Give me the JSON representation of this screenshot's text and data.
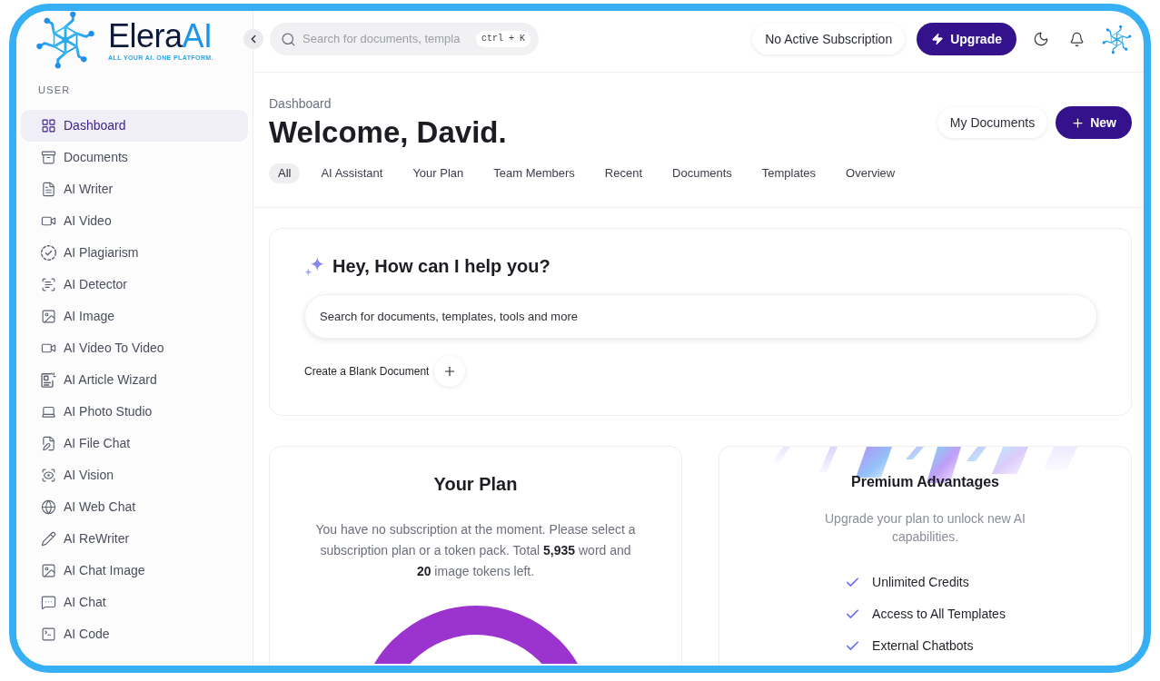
{
  "brand": {
    "name": "Elera",
    "name_accent": "AI",
    "tagline": "ALL YOUR AI. ONE PLATFORM."
  },
  "sidebar": {
    "section_label": "USER",
    "items": [
      {
        "label": "Dashboard",
        "kind": "grid",
        "selected": true
      },
      {
        "label": "Documents",
        "kind": "archive",
        "selected": false
      },
      {
        "label": "AI Writer",
        "kind": "document",
        "selected": false
      },
      {
        "label": "AI Video",
        "kind": "video",
        "selected": false
      },
      {
        "label": "AI Plagiarism",
        "kind": "checkcircle",
        "selected": false
      },
      {
        "label": "AI Detector",
        "kind": "scantext",
        "selected": false
      },
      {
        "label": "AI Image",
        "kind": "image",
        "selected": false
      },
      {
        "label": "AI Video To Video",
        "kind": "video",
        "selected": false
      },
      {
        "label": "AI Article Wizard",
        "kind": "article",
        "selected": false
      },
      {
        "label": "AI Photo Studio",
        "kind": "laptop",
        "selected": false
      },
      {
        "label": "AI File Chat",
        "kind": "filepen",
        "selected": false
      },
      {
        "label": "AI Vision",
        "kind": "scaneye",
        "selected": false
      },
      {
        "label": "AI Web Chat",
        "kind": "web",
        "selected": false
      },
      {
        "label": "AI ReWriter",
        "kind": "pencil",
        "selected": false
      },
      {
        "label": "AI Chat Image",
        "kind": "image",
        "selected": false
      },
      {
        "label": "AI Chat",
        "kind": "chat",
        "selected": false
      },
      {
        "label": "AI Code",
        "kind": "terminal",
        "selected": false
      }
    ]
  },
  "header": {
    "search": {
      "placeholder": "Search for documents, templa",
      "shortcut": "ctrl + K"
    },
    "subscription_status": "No Active Subscription",
    "upgrade_button": "Upgrade"
  },
  "page": {
    "breadcrumb": "Dashboard",
    "title": "Welcome, David.",
    "actions": [
      {
        "label": "My Documents",
        "kind": "secondary"
      },
      {
        "label": "New",
        "kind": "primary"
      }
    ]
  },
  "tabs": [
    {
      "label": "All",
      "selected": true
    },
    {
      "label": "AI Assistant",
      "selected": false
    },
    {
      "label": "Your Plan",
      "selected": false
    },
    {
      "label": "Team Members",
      "selected": false
    },
    {
      "label": "Recent",
      "selected": false
    },
    {
      "label": "Documents",
      "selected": false
    },
    {
      "label": "Templates",
      "selected": false
    },
    {
      "label": "Overview",
      "selected": false
    }
  ],
  "assistant_card": {
    "title": "Hey, How can I help you?",
    "search": {
      "placeholder": "Search for documents, templates, tools and more"
    },
    "create_label": "Create a Blank Document"
  },
  "plan_card": {
    "title": "Your Plan",
    "message": "You have no subscription at the moment. Please select a subscription plan or a token pack. Total **5,935** word and **20** image tokens left."
  },
  "premium_card": {
    "title": "Premium Advantages",
    "subtitle": "Upgrade your plan to unlock new AI capabilities.",
    "features": [
      "Unlimited Credits",
      "Access to All Templates",
      "External Chatbots"
    ]
  }
}
